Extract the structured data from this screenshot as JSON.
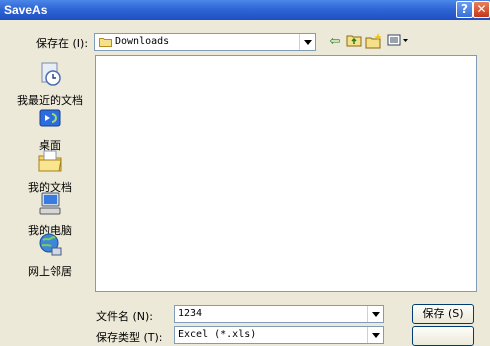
{
  "window": {
    "title": "SaveAs",
    "help_label": "?",
    "close_label": "✕"
  },
  "save_in": {
    "label": "保存在 (I):",
    "value": "Downloads"
  },
  "places": [
    {
      "label": "我最近的文档",
      "icon": "recent-docs-icon"
    },
    {
      "label": "桌面",
      "icon": "desktop-icon"
    },
    {
      "label": "我的文档",
      "icon": "my-documents-icon"
    },
    {
      "label": "我的电脑",
      "icon": "my-computer-icon"
    },
    {
      "label": "网上邻居",
      "icon": "network-icon"
    }
  ],
  "filename": {
    "label": "文件名 (N):",
    "value": "1234"
  },
  "filetype": {
    "label": "保存类型 (T):",
    "value": "Excel (*.xls)"
  },
  "buttons": {
    "save": "保存 (S)"
  },
  "colors": {
    "title_bar": "#2f66d6",
    "dialog_bg": "#ece9d8"
  }
}
